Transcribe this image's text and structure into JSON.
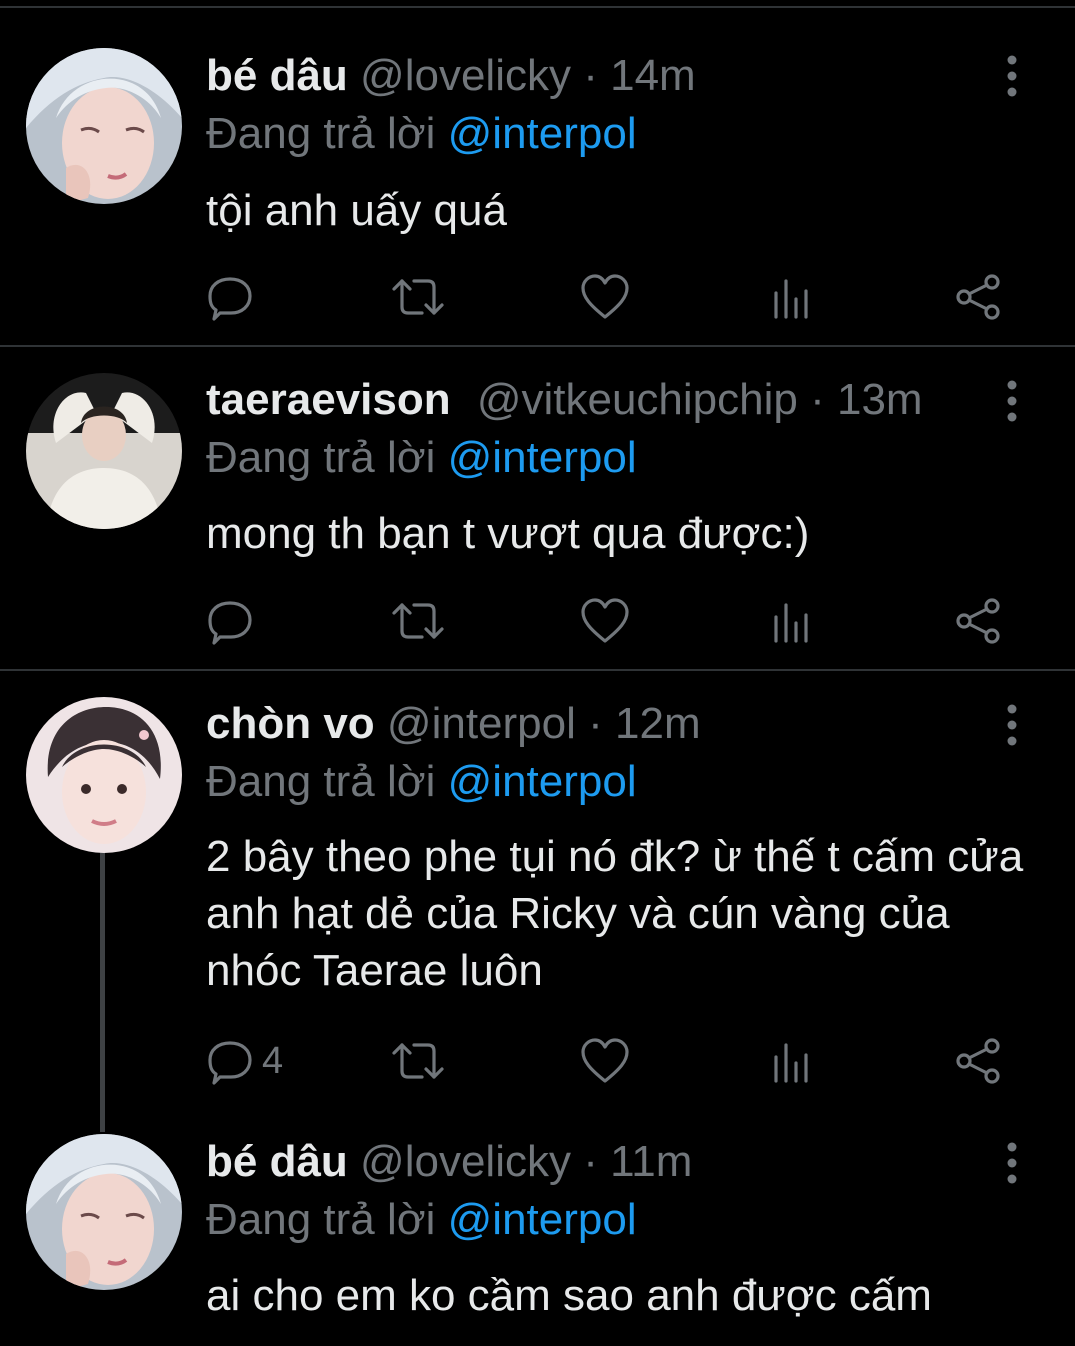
{
  "reply_prefix": "Đang trả lời",
  "tweets": [
    {
      "name": "bé dâu",
      "handle": "@lovelicky",
      "dot": "·",
      "time": "14m",
      "reply_to": "@interpol",
      "text": "tội anh uấy quá",
      "reply_count": ""
    },
    {
      "name": "taeraevison",
      "handle": "@vitkeuchipchip",
      "dot": "·",
      "time": "13m",
      "reply_to": "@interpol",
      "text": "mong th bạn t vượt qua được:)",
      "reply_count": ""
    },
    {
      "name": "chòn vo",
      "handle": "@interpol",
      "dot": "·",
      "time": "12m",
      "reply_to": "@interpol",
      "text": "2 bây theo phe tụi nó đk? ừ thế t cấm cửa anh hạt dẻ của Ricky và cún vàng của nhóc Taerae luôn",
      "reply_count": "4"
    },
    {
      "name": "bé dâu",
      "handle": "@lovelicky",
      "dot": "·",
      "time": "11m",
      "reply_to": "@interpol",
      "text": "ai cho em ko cầm sao anh được cấm",
      "reply_count": ""
    }
  ],
  "icons": {
    "reply": "reply-icon",
    "retweet": "retweet-icon",
    "like": "heart-icon",
    "views": "views-icon",
    "share": "share-icon",
    "more": "more-vertical-icon"
  },
  "colors": {
    "background": "#000000",
    "text": "#e7e9ea",
    "muted": "#71767b",
    "accent": "#1d9bf0",
    "divider": "#2f3336"
  }
}
